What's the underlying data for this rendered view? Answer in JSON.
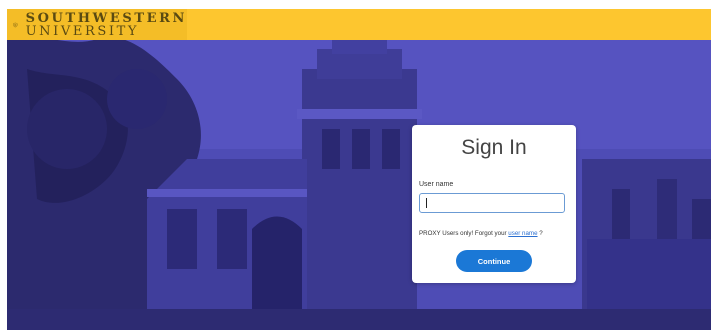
{
  "header": {
    "logo_line1": "SOUTHWESTERN",
    "logo_line2": "UNIVERSITY"
  },
  "signin": {
    "title": "Sign In",
    "username_label": "User name",
    "username_value": "",
    "proxy_text_before": "PROXY Users only! Forgot your ",
    "proxy_link": "user name",
    "proxy_text_after": " ?",
    "continue_label": "Continue"
  },
  "colors": {
    "header_bg": "#fdc62f",
    "overlay": "#4d4bb3",
    "button": "#1b78d6",
    "link": "#2b6fd0"
  },
  "icons": {
    "logo": "university-shield-icon"
  }
}
